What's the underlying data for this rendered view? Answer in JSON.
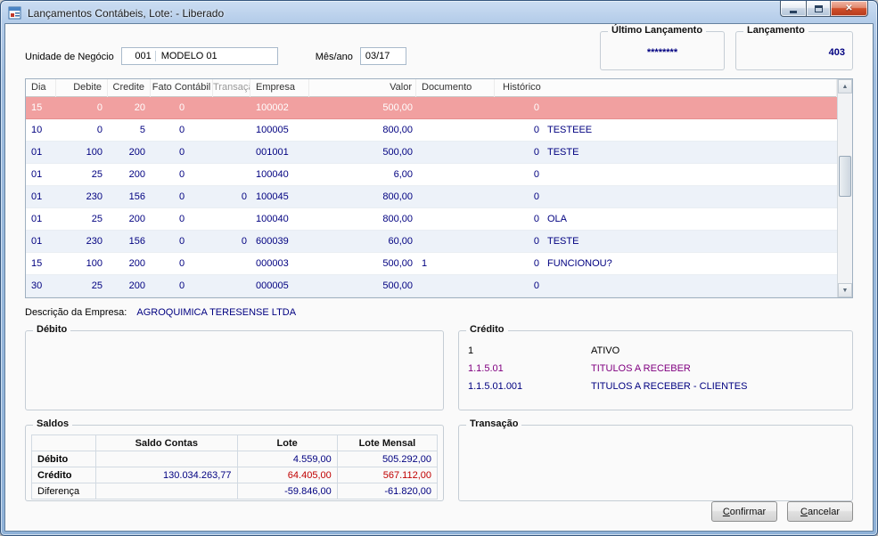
{
  "colors": {
    "navy_text": "#000080",
    "selected_row_bg": "#F1A0A0",
    "negative_red": "#C00000",
    "purple_account": "#800080",
    "titlebar_blue": "#A7C2E0"
  },
  "window": {
    "title": "Lançamentos Contábeis, Lote:  - Liberado"
  },
  "header": {
    "unidade_label": "Unidade de Negócio",
    "unidade_code": "001",
    "unidade_name": "MODELO 01",
    "mes_ano_label": "Mês/ano",
    "mes_ano_value": "03/17",
    "ultimo_lancamento_label": "Último Lançamento",
    "ultimo_lancamento_value": "********",
    "lancamento_label": "Lançamento",
    "lancamento_value": "403"
  },
  "table": {
    "columns": [
      "Dia",
      "Debite",
      "Credite",
      "Fato Contábil",
      "Transação",
      "Empresa",
      "Valor",
      "Documento",
      "Histórico"
    ],
    "rows": [
      {
        "dia": "15",
        "debite": "0",
        "credite": "20",
        "fato": "0",
        "transacao": "",
        "empresa": "100002",
        "valor": "500,00",
        "documento": "",
        "hist_num": "0",
        "historico": "",
        "selected": true
      },
      {
        "dia": "10",
        "debite": "0",
        "credite": "5",
        "fato": "0",
        "transacao": "",
        "empresa": "100005",
        "valor": "800,00",
        "documento": "",
        "hist_num": "0",
        "historico": "TESTEEE"
      },
      {
        "dia": "01",
        "debite": "100",
        "credite": "200",
        "fato": "0",
        "transacao": "",
        "empresa": "001001",
        "valor": "500,00",
        "documento": "",
        "hist_num": "0",
        "historico": "TESTE"
      },
      {
        "dia": "01",
        "debite": "25",
        "credite": "200",
        "fato": "0",
        "transacao": "",
        "empresa": "100040",
        "valor": "6,00",
        "documento": "",
        "hist_num": "0",
        "historico": ""
      },
      {
        "dia": "01",
        "debite": "230",
        "credite": "156",
        "fato": "0",
        "transacao": "0",
        "empresa": "100045",
        "valor": "800,00",
        "documento": "",
        "hist_num": "0",
        "historico": ""
      },
      {
        "dia": "01",
        "debite": "25",
        "credite": "200",
        "fato": "0",
        "transacao": "",
        "empresa": "100040",
        "valor": "800,00",
        "documento": "",
        "hist_num": "0",
        "historico": "OLA"
      },
      {
        "dia": "01",
        "debite": "230",
        "credite": "156",
        "fato": "0",
        "transacao": "0",
        "empresa": "600039",
        "valor": "60,00",
        "documento": "",
        "hist_num": "0",
        "historico": "TESTE"
      },
      {
        "dia": "15",
        "debite": "100",
        "credite": "200",
        "fato": "0",
        "transacao": "",
        "empresa": "000003",
        "valor": "500,00",
        "documento": "1",
        "hist_num": "0",
        "historico": "FUNCIONOU?"
      },
      {
        "dia": "30",
        "debite": "25",
        "credite": "200",
        "fato": "0",
        "transacao": "",
        "empresa": "000005",
        "valor": "500,00",
        "documento": "",
        "hist_num": "0",
        "historico": ""
      }
    ]
  },
  "descricao": {
    "label": "Descrição da Empresa:",
    "value": "AGROQUIMICA TERESENSE LTDA"
  },
  "debito_box": {
    "title": "Débito"
  },
  "credito_box": {
    "title": "Crédito",
    "rows": [
      {
        "code": "1",
        "name": "ATIVO"
      },
      {
        "code": "1.1.5.01",
        "name": "TITULOS A RECEBER"
      },
      {
        "code": "1.1.5.01.001",
        "name": "TITULOS A RECEBER - CLIENTES"
      }
    ]
  },
  "saldos": {
    "title": "Saldos",
    "col_headers": [
      "Saldo Contas",
      "Lote",
      "Lote Mensal"
    ],
    "rows": [
      {
        "label": "Débito",
        "saldo_contas": "",
        "lote": "4.559,00",
        "lote_mensal": "505.292,00"
      },
      {
        "label": "Crédito",
        "saldo_contas": "130.034.263,77",
        "lote": "64.405,00",
        "lote_mensal": "567.112,00"
      },
      {
        "label": "Diferença",
        "saldo_contas": "",
        "lote": "-59.846,00",
        "lote_mensal": "-61.820,00"
      }
    ]
  },
  "transacao_box": {
    "title": "Transação"
  },
  "buttons": {
    "confirm": "Confirmar",
    "cancel": "Cancelar"
  }
}
